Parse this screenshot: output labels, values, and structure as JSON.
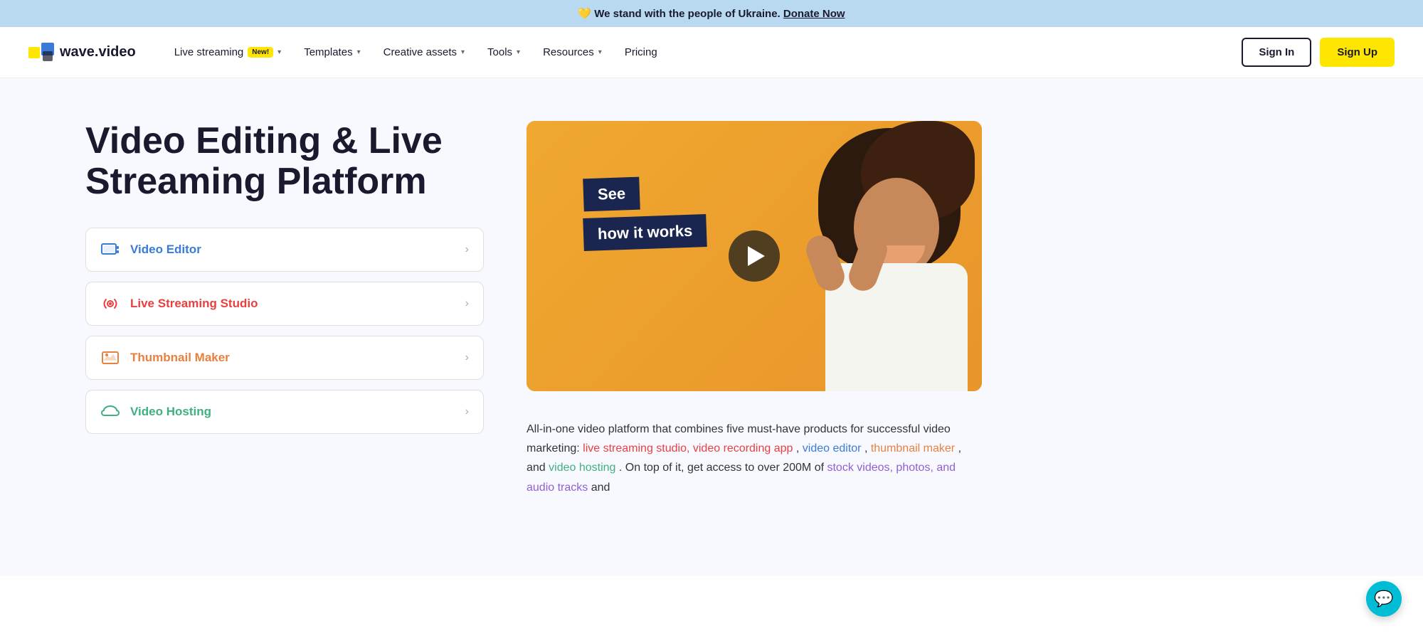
{
  "banner": {
    "emoji": "💛",
    "text": " We stand with the people of Ukraine.",
    "link_text": "Donate Now"
  },
  "nav": {
    "logo_text": "wave.video",
    "items": [
      {
        "id": "live-streaming",
        "label": "Live streaming",
        "badge": "New!",
        "has_dropdown": true
      },
      {
        "id": "templates",
        "label": "Templates",
        "has_dropdown": true
      },
      {
        "id": "creative-assets",
        "label": "Creative assets",
        "has_dropdown": true
      },
      {
        "id": "tools",
        "label": "Tools",
        "has_dropdown": true
      },
      {
        "id": "resources",
        "label": "Resources",
        "has_dropdown": true
      },
      {
        "id": "pricing",
        "label": "Pricing",
        "has_dropdown": false
      }
    ],
    "sign_in": "Sign In",
    "sign_up": "Sign Up"
  },
  "hero": {
    "title": "Video Editing & Live Streaming Platform",
    "features": [
      {
        "id": "video-editor",
        "label": "Video Editor",
        "color": "blue",
        "icon": "🎬"
      },
      {
        "id": "live-streaming-studio",
        "label": "Live Streaming Studio",
        "color": "red",
        "icon": "📡"
      },
      {
        "id": "thumbnail-maker",
        "label": "Thumbnail Maker",
        "color": "orange",
        "icon": "🖼️"
      },
      {
        "id": "video-hosting",
        "label": "Video Hosting",
        "color": "green",
        "icon": "☁️"
      }
    ],
    "video_badge_line1": "See",
    "video_badge_line2": "how it works",
    "description_parts": [
      "All-in-one video platform that combines five must-have products for successful video marketing: ",
      "live streaming studio, video recording app",
      ", ",
      "video editor",
      ", ",
      "thumbnail maker",
      ", and ",
      "video hosting",
      ". On top of it, get access to over 200M of ",
      "stock videos, photos, and audio tracks",
      " and"
    ]
  }
}
